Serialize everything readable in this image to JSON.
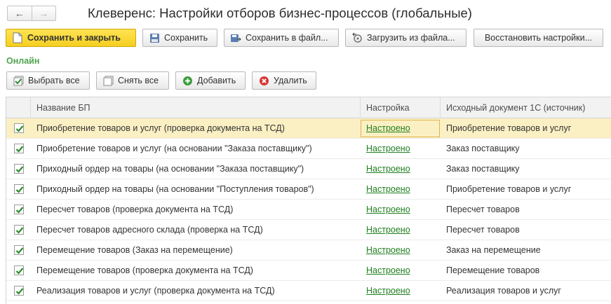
{
  "window": {
    "title": "Клеверенс: Настройки отборов бизнес-процессов (глобальные)"
  },
  "toolbar_main": {
    "save_close": "Сохранить и закрыть",
    "save": "Сохранить",
    "save_to_file": "Сохранить в файл...",
    "load_from_file": "Загрузить из файла...",
    "restore": "Восстановить настройки..."
  },
  "status": {
    "online": "Онлайн"
  },
  "toolbar_list": {
    "select_all": "Выбрать все",
    "deselect_all": "Снять все",
    "add": "Добавить",
    "delete": "Удалить"
  },
  "table": {
    "headers": [
      "Название БП",
      "Настройка",
      "Исходный документ 1С (источник)"
    ],
    "rows": [
      {
        "checked": true,
        "name": "Приобретение товаров и услуг (проверка документа на ТСД)",
        "setting": "Настроено",
        "source": "Приобретение товаров и услуг"
      },
      {
        "checked": true,
        "name": "Приобретение товаров и услуг (на основании \"Заказа поставщику\")",
        "setting": "Настроено",
        "source": "Заказ поставщику"
      },
      {
        "checked": true,
        "name": "Приходный ордер на товары (на основании \"Заказа поставщику\")",
        "setting": "Настроено",
        "source": "Заказ поставщику"
      },
      {
        "checked": true,
        "name": "Приходный ордер на товары (на основании \"Поступления товаров\")",
        "setting": "Настроено",
        "source": "Приобретение товаров и услуг"
      },
      {
        "checked": true,
        "name": "Пересчет товаров (проверка документа на ТСД)",
        "setting": "Настроено",
        "source": "Пересчет товаров"
      },
      {
        "checked": true,
        "name": "Пересчет товаров адресного склада (проверка на ТСД)",
        "setting": "Настроено",
        "source": "Пересчет товаров"
      },
      {
        "checked": true,
        "name": "Перемещение товаров (Заказ на перемещение)",
        "setting": "Настроено",
        "source": "Заказ на перемещение"
      },
      {
        "checked": true,
        "name": "Перемещение товаров (проверка документа на ТСД)",
        "setting": "Настроено",
        "source": "Перемещение товаров"
      },
      {
        "checked": true,
        "name": "Реализация товаров и услуг (проверка документа на ТСД)",
        "setting": "Настроено",
        "source": "Реализация товаров и услуг"
      }
    ]
  },
  "colors": {
    "accent_yellow": "#f5cf20",
    "online_green": "#4ea34e",
    "link_green": "#1e7f1e",
    "selected_row": "#fbf0c4"
  }
}
